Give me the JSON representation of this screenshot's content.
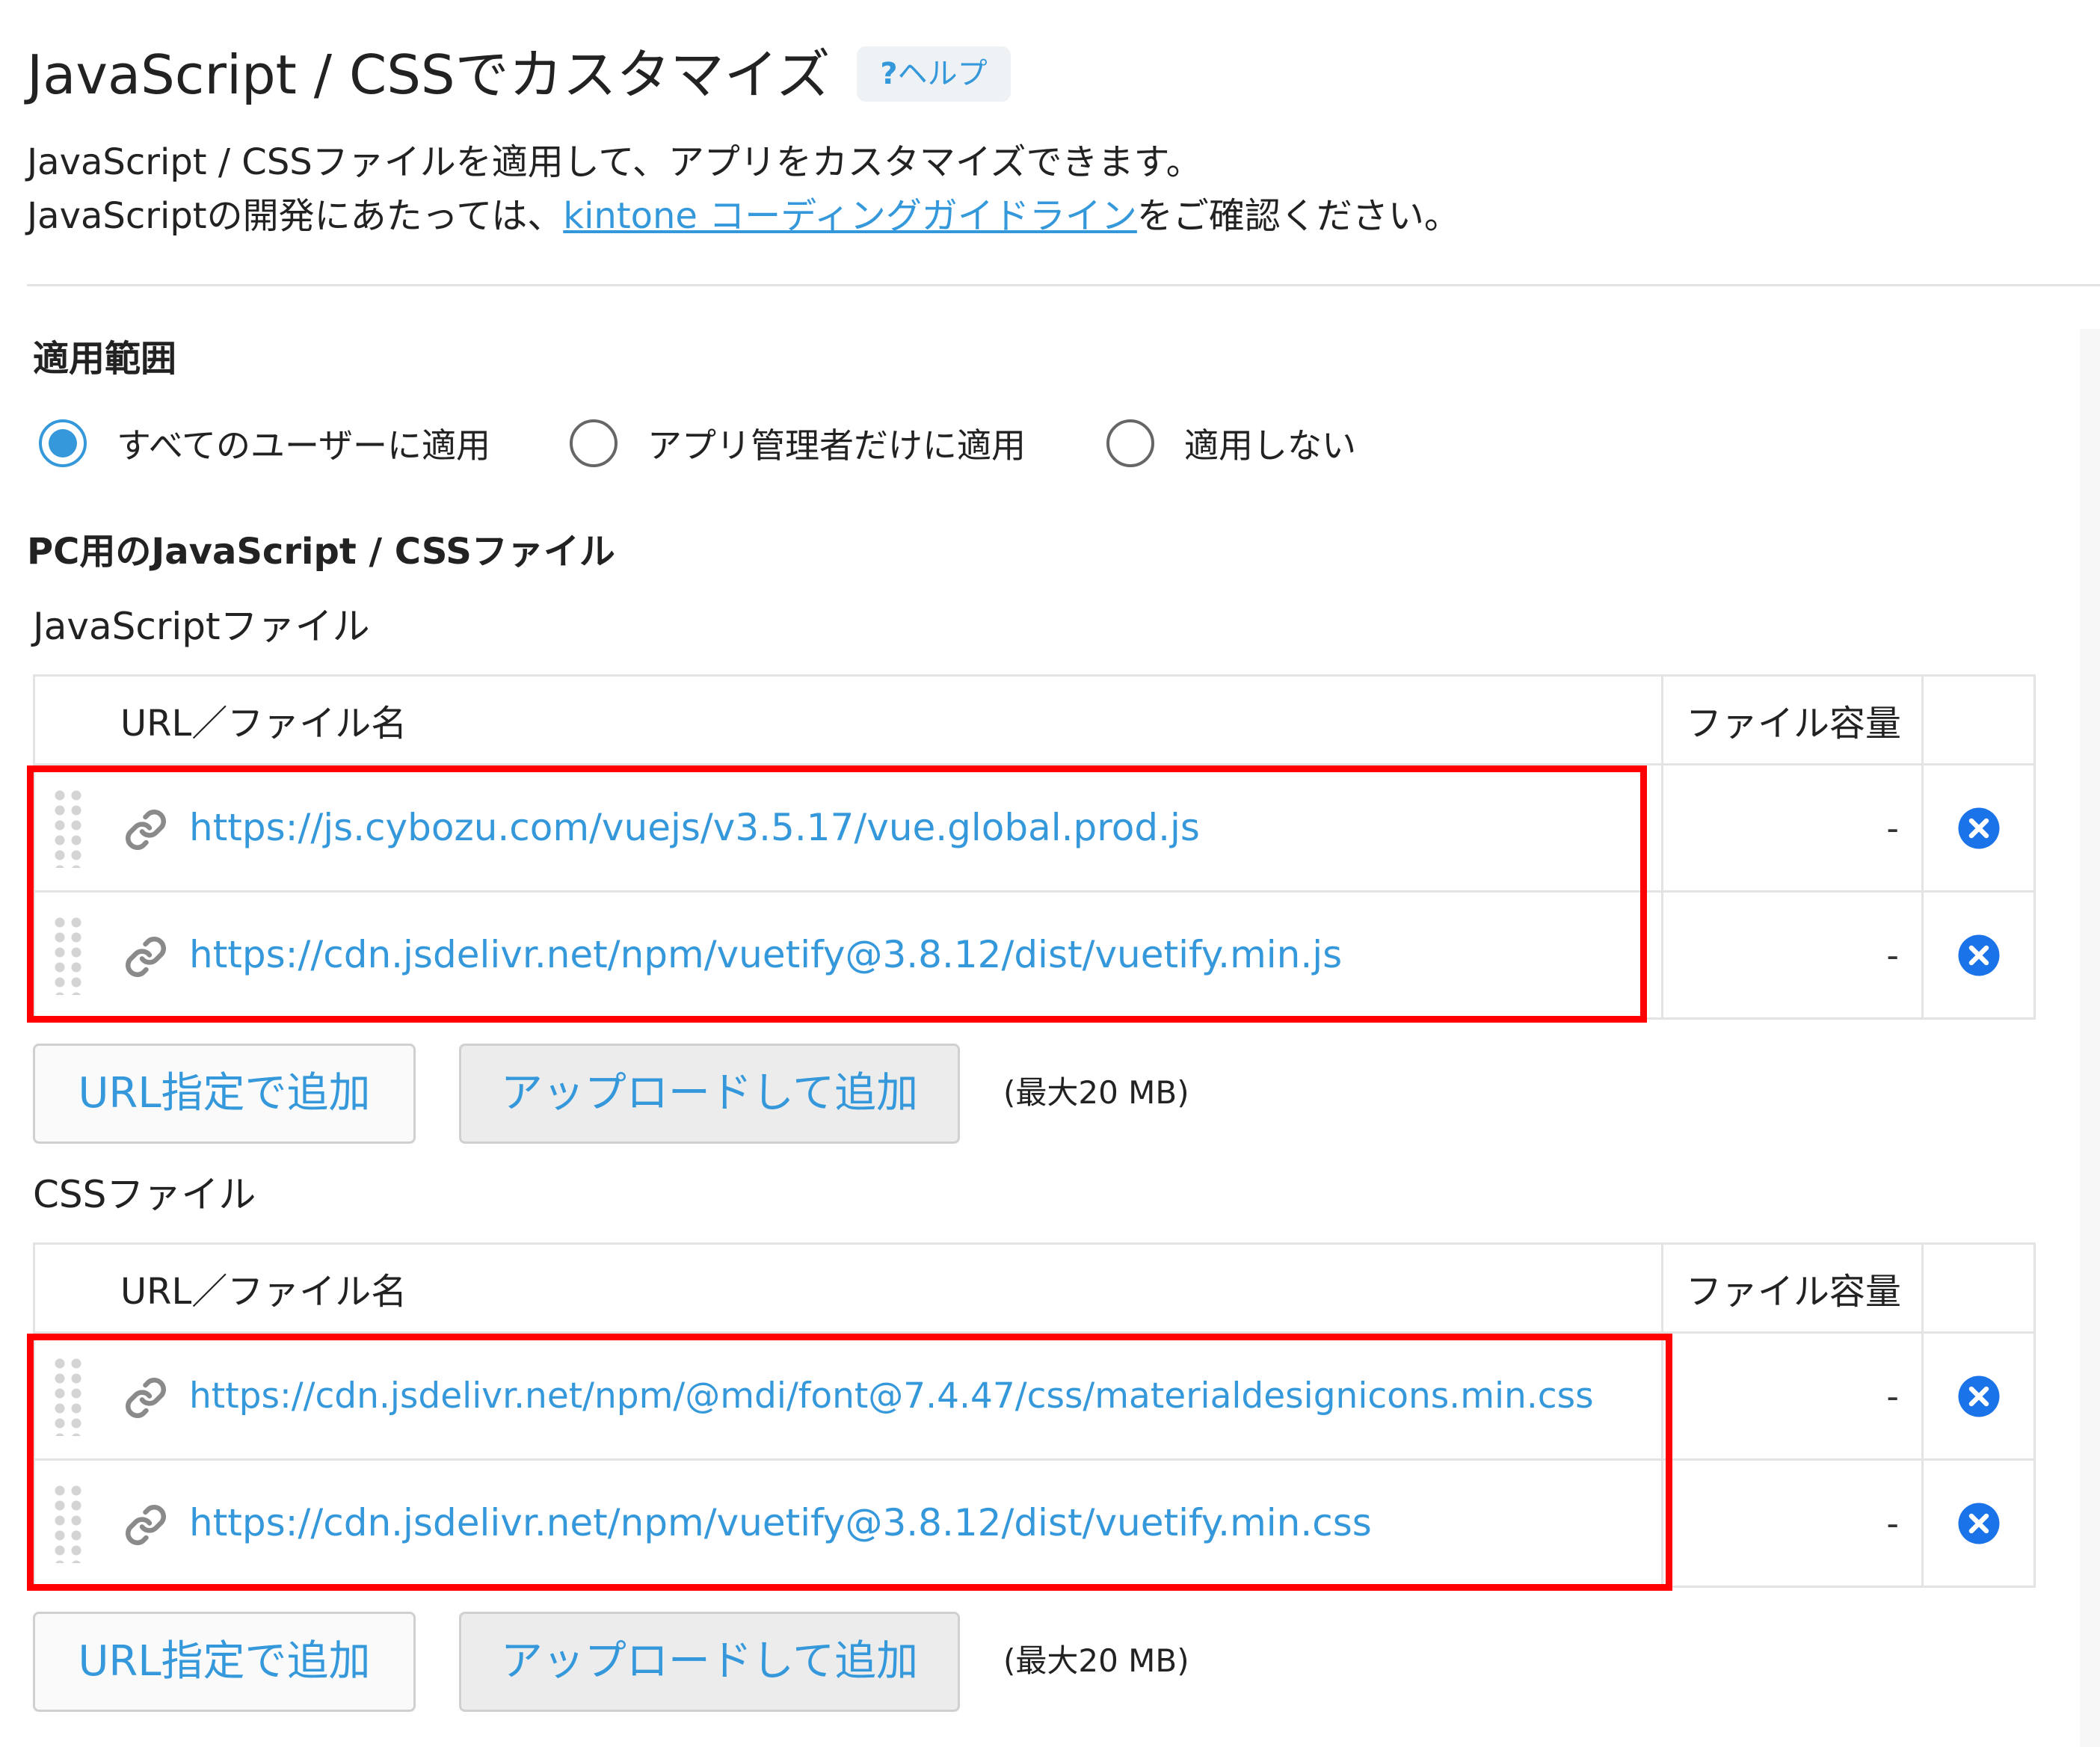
{
  "header": {
    "title": "JavaScript / CSSでカスタマイズ",
    "help_mark": "?",
    "help_label": "ヘルプ",
    "desc_line1": "JavaScript / CSSファイルを適用して、アプリをカスタマイズできます。",
    "desc_line2_before": "JavaScriptの開発にあたっては、",
    "desc_line2_link": "kintone コーディングガイドライン",
    "desc_line2_after": "をご確認ください。"
  },
  "scope": {
    "title": "適用範囲",
    "options": [
      {
        "label": "すべてのユーザーに適用",
        "checked": true
      },
      {
        "label": "アプリ管理者だけに適用",
        "checked": false
      },
      {
        "label": "適用しない",
        "checked": false
      }
    ]
  },
  "pc_section": {
    "title": "PC用のJavaScript / CSSファイル",
    "js": {
      "subtitle": "JavaScriptファイル",
      "col_name": "URL／ファイル名",
      "col_size": "ファイル容量",
      "rows": [
        {
          "url": "https://js.cybozu.com/vuejs/v3.5.17/vue.global.prod.js",
          "size": "-"
        },
        {
          "url": "https://cdn.jsdelivr.net/npm/vuetify@3.8.12/dist/vuetify.min.js",
          "size": "-"
        }
      ],
      "add_url_label": "URL指定で追加",
      "upload_label": "アップロードして追加",
      "max_size": "(最大20 MB)"
    },
    "css": {
      "subtitle": "CSSファイル",
      "col_name": "URL／ファイル名",
      "col_size": "ファイル容量",
      "rows": [
        {
          "url": "https://cdn.jsdelivr.net/npm/@mdi/font@7.4.47/css/materialdesignicons.min.css",
          "size": "-"
        },
        {
          "url": "https://cdn.jsdelivr.net/npm/vuetify@3.8.12/dist/vuetify.min.css",
          "size": "-"
        }
      ],
      "add_url_label": "URL指定で追加",
      "upload_label": "アップロードして追加",
      "max_size": "(最大20 MB)"
    }
  },
  "colors": {
    "accent": "#3498db",
    "highlight": "#ff0000",
    "border": "#e3e3e3"
  },
  "icons": {
    "help": "question-icon",
    "drag": "drag-handle-icon",
    "link": "link-icon",
    "delete": "close-circle-icon"
  }
}
